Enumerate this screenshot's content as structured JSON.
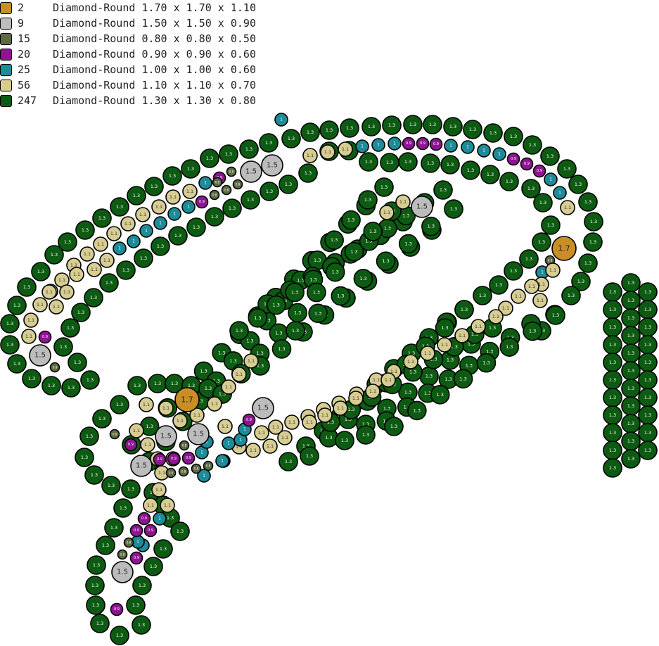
{
  "legend": [
    {
      "count": "2",
      "shape": "Diamond-Round",
      "size": "1.70 x 1.70 x 1.10",
      "color": "#c98e25"
    },
    {
      "count": "9",
      "shape": "Diamond-Round",
      "size": "1.50 x 1.50 x 0.90",
      "color": "#bcbcbc"
    },
    {
      "count": "15",
      "shape": "Diamond-Round",
      "size": "0.80 x 0.80 x 0.50",
      "color": "#5c6a44"
    },
    {
      "count": "20",
      "shape": "Diamond-Round",
      "size": "0.90 x 0.90 x 0.60",
      "color": "#8e1592"
    },
    {
      "count": "25",
      "shape": "Diamond-Round",
      "size": "1.00 x 1.00 x 0.60",
      "color": "#1d8b98"
    },
    {
      "count": "56",
      "shape": "Diamond-Round",
      "size": "1.10 x 1.10 x 0.70",
      "color": "#d7cd92"
    },
    {
      "count": "247",
      "shape": "Diamond-Round",
      "size": "1.30 x 1.30 x 0.80",
      "color": "#0d5b12"
    }
  ],
  "stone_labels": {
    "large": "1.7",
    "medium": "1.5",
    "green": "1.3",
    "beige": "1.1",
    "teal": "1",
    "purple": "0.9",
    "olive": "0.8"
  }
}
